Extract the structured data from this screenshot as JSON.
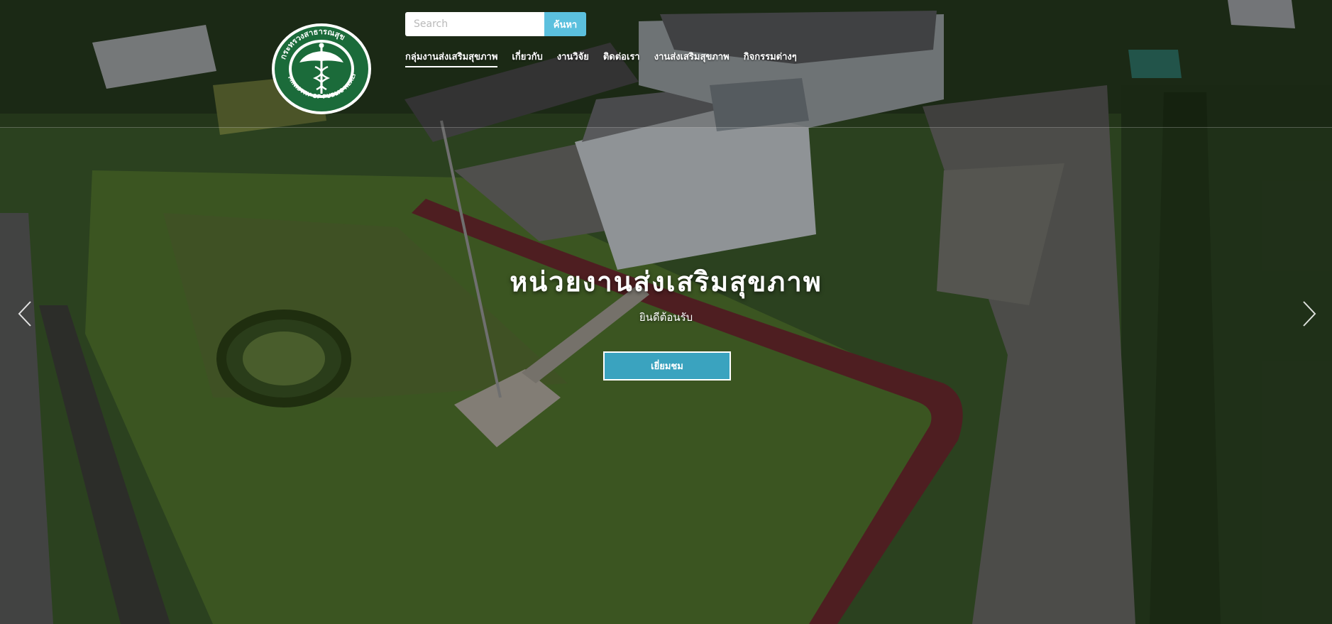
{
  "search": {
    "placeholder": "Search",
    "button_label": "ค้นหา"
  },
  "nav": {
    "items": [
      {
        "label": "กลุ่มงานส่งเสริมสุขภาพ",
        "active": true
      },
      {
        "label": "เกี่ยวกับ"
      },
      {
        "label": "งานวิจัย"
      },
      {
        "label": "ติดต่อเรา"
      },
      {
        "label": "งานส่งเสริมสุขภาพ"
      },
      {
        "label": "กิจกรรมต่างๆ"
      }
    ]
  },
  "logo": {
    "ring_text": "กระทรวงสาธารณสุข MINISTRY OF PUBLIC HEALTH",
    "color": "#1b6b3a"
  },
  "hero": {
    "title": "หน่วยงานส่งเสริมสุขภาพ",
    "subtitle": "ยินดีต้อนรับ",
    "button_label": "เยี่ยมชม"
  },
  "colors": {
    "accent": "#5bc0de",
    "button": "#3aa3bf"
  },
  "icons": {
    "prev": "chevron-left-icon",
    "next": "chevron-right-icon"
  }
}
